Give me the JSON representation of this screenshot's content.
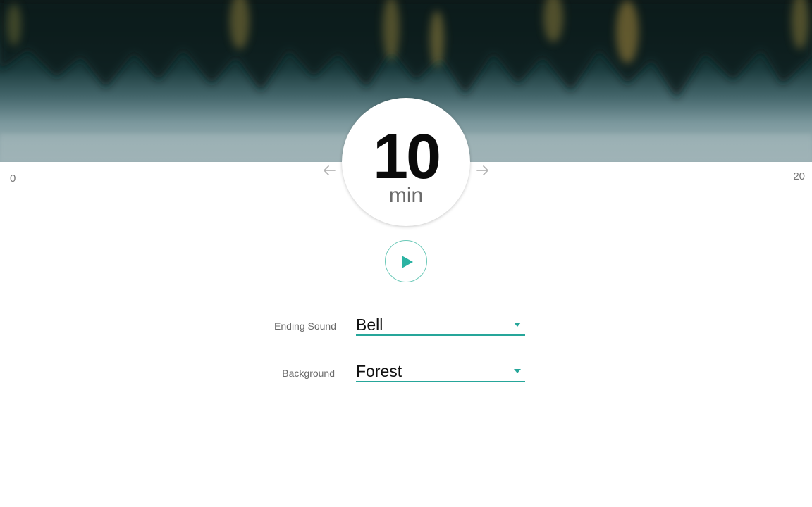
{
  "timer": {
    "value": "10",
    "unit": "min",
    "range_min": "0",
    "range_max": "20"
  },
  "icons": {
    "decrease": "arrow-left-icon",
    "increase": "arrow-right-icon",
    "play": "play-icon",
    "dropdown": "caret-down-icon"
  },
  "settings": {
    "ending_sound": {
      "label": "Ending Sound",
      "value": "Bell"
    },
    "background": {
      "label": "Background",
      "value": "Forest"
    }
  },
  "colors": {
    "accent": "#26a69a",
    "play_icon": "#2bb3a3",
    "play_border": "#6cc9b8",
    "arrow": "#b5b5b5"
  }
}
